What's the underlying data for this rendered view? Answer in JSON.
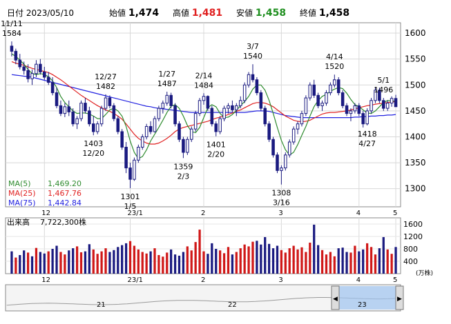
{
  "header": {
    "date_label": "日付",
    "date": "2023/05/10",
    "open_label": "始値",
    "open": "1,474",
    "high_label": "高値",
    "high": "1,481",
    "low_label": "安値",
    "low": "1,458",
    "close_label": "終値",
    "close": "1,458"
  },
  "colors": {
    "up": "#1a1a80",
    "down": "#1a1a80",
    "up_fill": "#ffffff",
    "ma5": "#2e8b2e",
    "ma25": "#e02020",
    "ma75": "#2020e0",
    "vol_up": "#d01818",
    "vol_down": "#1a1a80"
  },
  "chart_data": [
    {
      "type": "candlestick",
      "x_tick_labels": [
        "12",
        "23/1",
        "2",
        "3",
        "4",
        "5"
      ],
      "y_ticks": [
        1300,
        1350,
        1400,
        1450,
        1500,
        1550,
        1600
      ],
      "ylim": [
        1265,
        1620
      ],
      "grid": true,
      "annotations": [
        {
          "text": "11/11",
          "value": "1584"
        },
        {
          "text": "1403",
          "value": "12/20"
        },
        {
          "text": "12/27",
          "value": "1482"
        },
        {
          "text": "1301",
          "value": "1/5"
        },
        {
          "text": "1/27",
          "value": "1487"
        },
        {
          "text": "1359",
          "value": "2/3"
        },
        {
          "text": "2/14",
          "value": "1484"
        },
        {
          "text": "1401",
          "value": "2/20"
        },
        {
          "text": "3/7",
          "value": "1540"
        },
        {
          "text": "1308",
          "value": "3/16"
        },
        {
          "text": "4/14",
          "value": "1520"
        },
        {
          "text": "5/1",
          "value": "1496"
        },
        {
          "text": "1418",
          "value": "4/27"
        }
      ],
      "legend": [
        {
          "label": "MA(5)",
          "value": "1,469.20"
        },
        {
          "label": "MA(25)",
          "value": "1,467.76"
        },
        {
          "label": "MA(75)",
          "value": "1,442.84"
        }
      ],
      "candles": [
        [
          1575,
          1584,
          1555,
          1565
        ],
        [
          1565,
          1570,
          1540,
          1548
        ],
        [
          1548,
          1560,
          1530,
          1535
        ],
        [
          1535,
          1545,
          1520,
          1528
        ],
        [
          1528,
          1540,
          1505,
          1512
        ],
        [
          1512,
          1530,
          1500,
          1522
        ],
        [
          1522,
          1548,
          1515,
          1540
        ],
        [
          1540,
          1550,
          1520,
          1525
        ],
        [
          1525,
          1535,
          1510,
          1515
        ],
        [
          1515,
          1525,
          1500,
          1505
        ],
        [
          1505,
          1515,
          1480,
          1485
        ],
        [
          1485,
          1495,
          1455,
          1460
        ],
        [
          1460,
          1470,
          1440,
          1445
        ],
        [
          1445,
          1465,
          1438,
          1458
        ],
        [
          1458,
          1470,
          1440,
          1448
        ],
        [
          1448,
          1455,
          1420,
          1425
        ],
        [
          1425,
          1440,
          1415,
          1435
        ],
        [
          1435,
          1470,
          1430,
          1465
        ],
        [
          1465,
          1475,
          1445,
          1450
        ],
        [
          1450,
          1458,
          1420,
          1425
        ],
        [
          1425,
          1440,
          1403,
          1410
        ],
        [
          1410,
          1430,
          1405,
          1425
        ],
        [
          1425,
          1460,
          1420,
          1455
        ],
        [
          1455,
          1482,
          1450,
          1475
        ],
        [
          1475,
          1480,
          1455,
          1460
        ],
        [
          1460,
          1465,
          1430,
          1435
        ],
        [
          1435,
          1440,
          1405,
          1410
        ],
        [
          1410,
          1415,
          1375,
          1380
        ],
        [
          1380,
          1390,
          1330,
          1340
        ],
        [
          1340,
          1350,
          1301,
          1318
        ],
        [
          1318,
          1360,
          1315,
          1355
        ],
        [
          1355,
          1385,
          1350,
          1380
        ],
        [
          1380,
          1405,
          1375,
          1400
        ],
        [
          1400,
          1425,
          1395,
          1420
        ],
        [
          1420,
          1430,
          1405,
          1410
        ],
        [
          1410,
          1440,
          1408,
          1435
        ],
        [
          1435,
          1460,
          1430,
          1455
        ],
        [
          1455,
          1470,
          1445,
          1465
        ],
        [
          1465,
          1487,
          1460,
          1480
        ],
        [
          1480,
          1485,
          1455,
          1460
        ],
        [
          1460,
          1465,
          1420,
          1425
        ],
        [
          1425,
          1430,
          1390,
          1395
        ],
        [
          1395,
          1400,
          1359,
          1370
        ],
        [
          1370,
          1400,
          1365,
          1395
        ],
        [
          1395,
          1420,
          1390,
          1415
        ],
        [
          1415,
          1450,
          1410,
          1445
        ],
        [
          1445,
          1475,
          1440,
          1470
        ],
        [
          1470,
          1484,
          1462,
          1478
        ],
        [
          1478,
          1480,
          1450,
          1455
        ],
        [
          1455,
          1460,
          1420,
          1425
        ],
        [
          1425,
          1430,
          1401,
          1410
        ],
        [
          1410,
          1440,
          1405,
          1435
        ],
        [
          1435,
          1460,
          1430,
          1455
        ],
        [
          1455,
          1465,
          1445,
          1460
        ],
        [
          1460,
          1470,
          1448,
          1452
        ],
        [
          1452,
          1465,
          1440,
          1460
        ],
        [
          1460,
          1478,
          1455,
          1470
        ],
        [
          1470,
          1505,
          1465,
          1500
        ],
        [
          1500,
          1525,
          1495,
          1520
        ],
        [
          1520,
          1540,
          1505,
          1510
        ],
        [
          1510,
          1515,
          1480,
          1485
        ],
        [
          1485,
          1490,
          1450,
          1455
        ],
        [
          1455,
          1460,
          1420,
          1425
        ],
        [
          1425,
          1430,
          1390,
          1395
        ],
        [
          1395,
          1400,
          1360,
          1365
        ],
        [
          1365,
          1370,
          1330,
          1335
        ],
        [
          1335,
          1345,
          1308,
          1340
        ],
        [
          1340,
          1370,
          1335,
          1365
        ],
        [
          1365,
          1395,
          1360,
          1390
        ],
        [
          1390,
          1420,
          1385,
          1415
        ],
        [
          1415,
          1430,
          1405,
          1425
        ],
        [
          1425,
          1450,
          1420,
          1445
        ],
        [
          1445,
          1480,
          1440,
          1475
        ],
        [
          1475,
          1505,
          1470,
          1500
        ],
        [
          1500,
          1510,
          1475,
          1480
        ],
        [
          1480,
          1485,
          1455,
          1460
        ],
        [
          1460,
          1470,
          1450,
          1465
        ],
        [
          1465,
          1490,
          1460,
          1485
        ],
        [
          1485,
          1505,
          1480,
          1500
        ],
        [
          1500,
          1520,
          1495,
          1510
        ],
        [
          1510,
          1515,
          1480,
          1485
        ],
        [
          1485,
          1490,
          1455,
          1460
        ],
        [
          1460,
          1465,
          1440,
          1445
        ],
        [
          1445,
          1455,
          1430,
          1450
        ],
        [
          1450,
          1465,
          1445,
          1460
        ],
        [
          1460,
          1465,
          1440,
          1445
        ],
        [
          1445,
          1450,
          1418,
          1425
        ],
        [
          1425,
          1455,
          1422,
          1450
        ],
        [
          1450,
          1475,
          1445,
          1470
        ],
        [
          1470,
          1496,
          1465,
          1490
        ],
        [
          1490,
          1495,
          1465,
          1470
        ],
        [
          1470,
          1475,
          1450,
          1455
        ],
        [
          1455,
          1470,
          1450,
          1465
        ],
        [
          1465,
          1478,
          1458,
          1474
        ],
        [
          1474,
          1481,
          1458,
          1458
        ]
      ],
      "ma5": [
        1560,
        1555,
        1548,
        1540,
        1530,
        1522,
        1520,
        1522,
        1520,
        1516,
        1508,
        1495,
        1478,
        1466,
        1458,
        1450,
        1445,
        1446,
        1446,
        1444,
        1440,
        1435,
        1435,
        1443,
        1452,
        1455,
        1450,
        1440,
        1420,
        1392,
        1370,
        1358,
        1362,
        1375,
        1392,
        1405,
        1418,
        1432,
        1447,
        1459,
        1462,
        1455,
        1440,
        1422,
        1410,
        1408,
        1418,
        1437,
        1456,
        1462,
        1458,
        1445,
        1437,
        1438,
        1443,
        1451,
        1460,
        1468,
        1478,
        1492,
        1500,
        1500,
        1490,
        1470,
        1445,
        1418,
        1393,
        1375,
        1365,
        1370,
        1385,
        1403,
        1420,
        1440,
        1458,
        1470,
        1478,
        1482,
        1488,
        1492,
        1495,
        1493,
        1484,
        1472,
        1462,
        1458,
        1452,
        1446,
        1445,
        1450,
        1458,
        1466,
        1470,
        1469,
        1469
      ],
      "ma25": [
        1545,
        1542,
        1540,
        1538,
        1535,
        1532,
        1530,
        1528,
        1526,
        1524,
        1520,
        1515,
        1510,
        1504,
        1498,
        1492,
        1486,
        1480,
        1475,
        1470,
        1465,
        1460,
        1456,
        1452,
        1449,
        1445,
        1440,
        1434,
        1425,
        1415,
        1405,
        1397,
        1392,
        1388,
        1386,
        1386,
        1388,
        1392,
        1397,
        1403,
        1410,
        1415,
        1418,
        1420,
        1422,
        1424,
        1426,
        1428,
        1430,
        1433,
        1436,
        1438,
        1440,
        1443,
        1446,
        1449,
        1452,
        1456,
        1460,
        1464,
        1466,
        1466,
        1465,
        1462,
        1458,
        1452,
        1446,
        1440,
        1436,
        1432,
        1430,
        1429,
        1430,
        1432,
        1436,
        1440,
        1444,
        1446,
        1447,
        1447,
        1448,
        1449,
        1450,
        1452,
        1454,
        1456,
        1458,
        1460,
        1461,
        1463,
        1464,
        1465,
        1466,
        1467,
        1468
      ],
      "ma75": [
        1520,
        1519,
        1518,
        1517,
        1516,
        1515,
        1513,
        1511,
        1509,
        1507,
        1505,
        1503,
        1501,
        1499,
        1497,
        1495,
        1493,
        1491,
        1489,
        1487,
        1485,
        1483,
        1481,
        1479,
        1477,
        1475,
        1473,
        1471,
        1469,
        1467,
        1465,
        1463,
        1461,
        1459,
        1458,
        1456,
        1455,
        1454,
        1453,
        1452,
        1451,
        1450,
        1449,
        1448,
        1447,
        1447,
        1447,
        1447,
        1447,
        1447,
        1447,
        1447,
        1447,
        1447,
        1447,
        1447,
        1447,
        1447,
        1448,
        1449,
        1450,
        1450,
        1450,
        1449,
        1447,
        1445,
        1443,
        1441,
        1440,
        1439,
        1438,
        1437,
        1437,
        1437,
        1437,
        1437,
        1437,
        1437,
        1437,
        1437,
        1437,
        1437,
        1437,
        1437,
        1438,
        1438,
        1439,
        1439,
        1440,
        1440,
        1441,
        1441,
        1442,
        1442,
        1443
      ]
    },
    {
      "type": "bar",
      "title": "出来高",
      "title_value": "7,722,300株",
      "unit": "(万株)",
      "y_ticks": [
        400,
        800,
        1200,
        1600
      ],
      "ylim": [
        0,
        1800
      ],
      "values": [
        720,
        520,
        600,
        750,
        680,
        560,
        830,
        700,
        650,
        720,
        800,
        900,
        700,
        620,
        750,
        820,
        880,
        690,
        720,
        950,
        780,
        640,
        720,
        820,
        700,
        760,
        860,
        920,
        980,
        1050,
        900,
        780,
        700,
        650,
        720,
        820,
        600,
        550,
        680,
        780,
        620,
        580,
        700,
        880,
        750,
        1020,
        1420,
        720,
        640,
        980,
        800,
        750,
        660,
        860,
        620,
        700,
        820,
        940,
        880,
        1030,
        1060,
        940,
        1180,
        960,
        820,
        900,
        760,
        680,
        820,
        900,
        780,
        850,
        700,
        1000,
        1580,
        920,
        760,
        620,
        700,
        560,
        820,
        840,
        700,
        680,
        900,
        720,
        780,
        980,
        860,
        620,
        820,
        1180,
        780,
        640,
        860
      ],
      "up": [
        0,
        1,
        0,
        0,
        1,
        0,
        1,
        0,
        0,
        1,
        0,
        0,
        1,
        1,
        0,
        0,
        1,
        1,
        0,
        0,
        1,
        1,
        1,
        1,
        0,
        0,
        0,
        0,
        0,
        1,
        1,
        1,
        1,
        1,
        0,
        1,
        1,
        1,
        1,
        0,
        0,
        0,
        0,
        1,
        1,
        1,
        1,
        1,
        0,
        0,
        0,
        1,
        1,
        1,
        0,
        1,
        1,
        1,
        1,
        1,
        0,
        0,
        0,
        0,
        0,
        0,
        1,
        1,
        1,
        1,
        1,
        1,
        1,
        1,
        0,
        0,
        1,
        1,
        1,
        1,
        0,
        0,
        0,
        1,
        1,
        0,
        0,
        1,
        1,
        1,
        0,
        0,
        1,
        1,
        0
      ]
    }
  ],
  "volume_x_labels": [
    "12",
    "23/1",
    "2",
    "3",
    "4",
    "5"
  ],
  "navigator": {
    "labels": [
      "21",
      "22",
      "23"
    ],
    "left_handle": "◀",
    "right_handle": "▶"
  }
}
